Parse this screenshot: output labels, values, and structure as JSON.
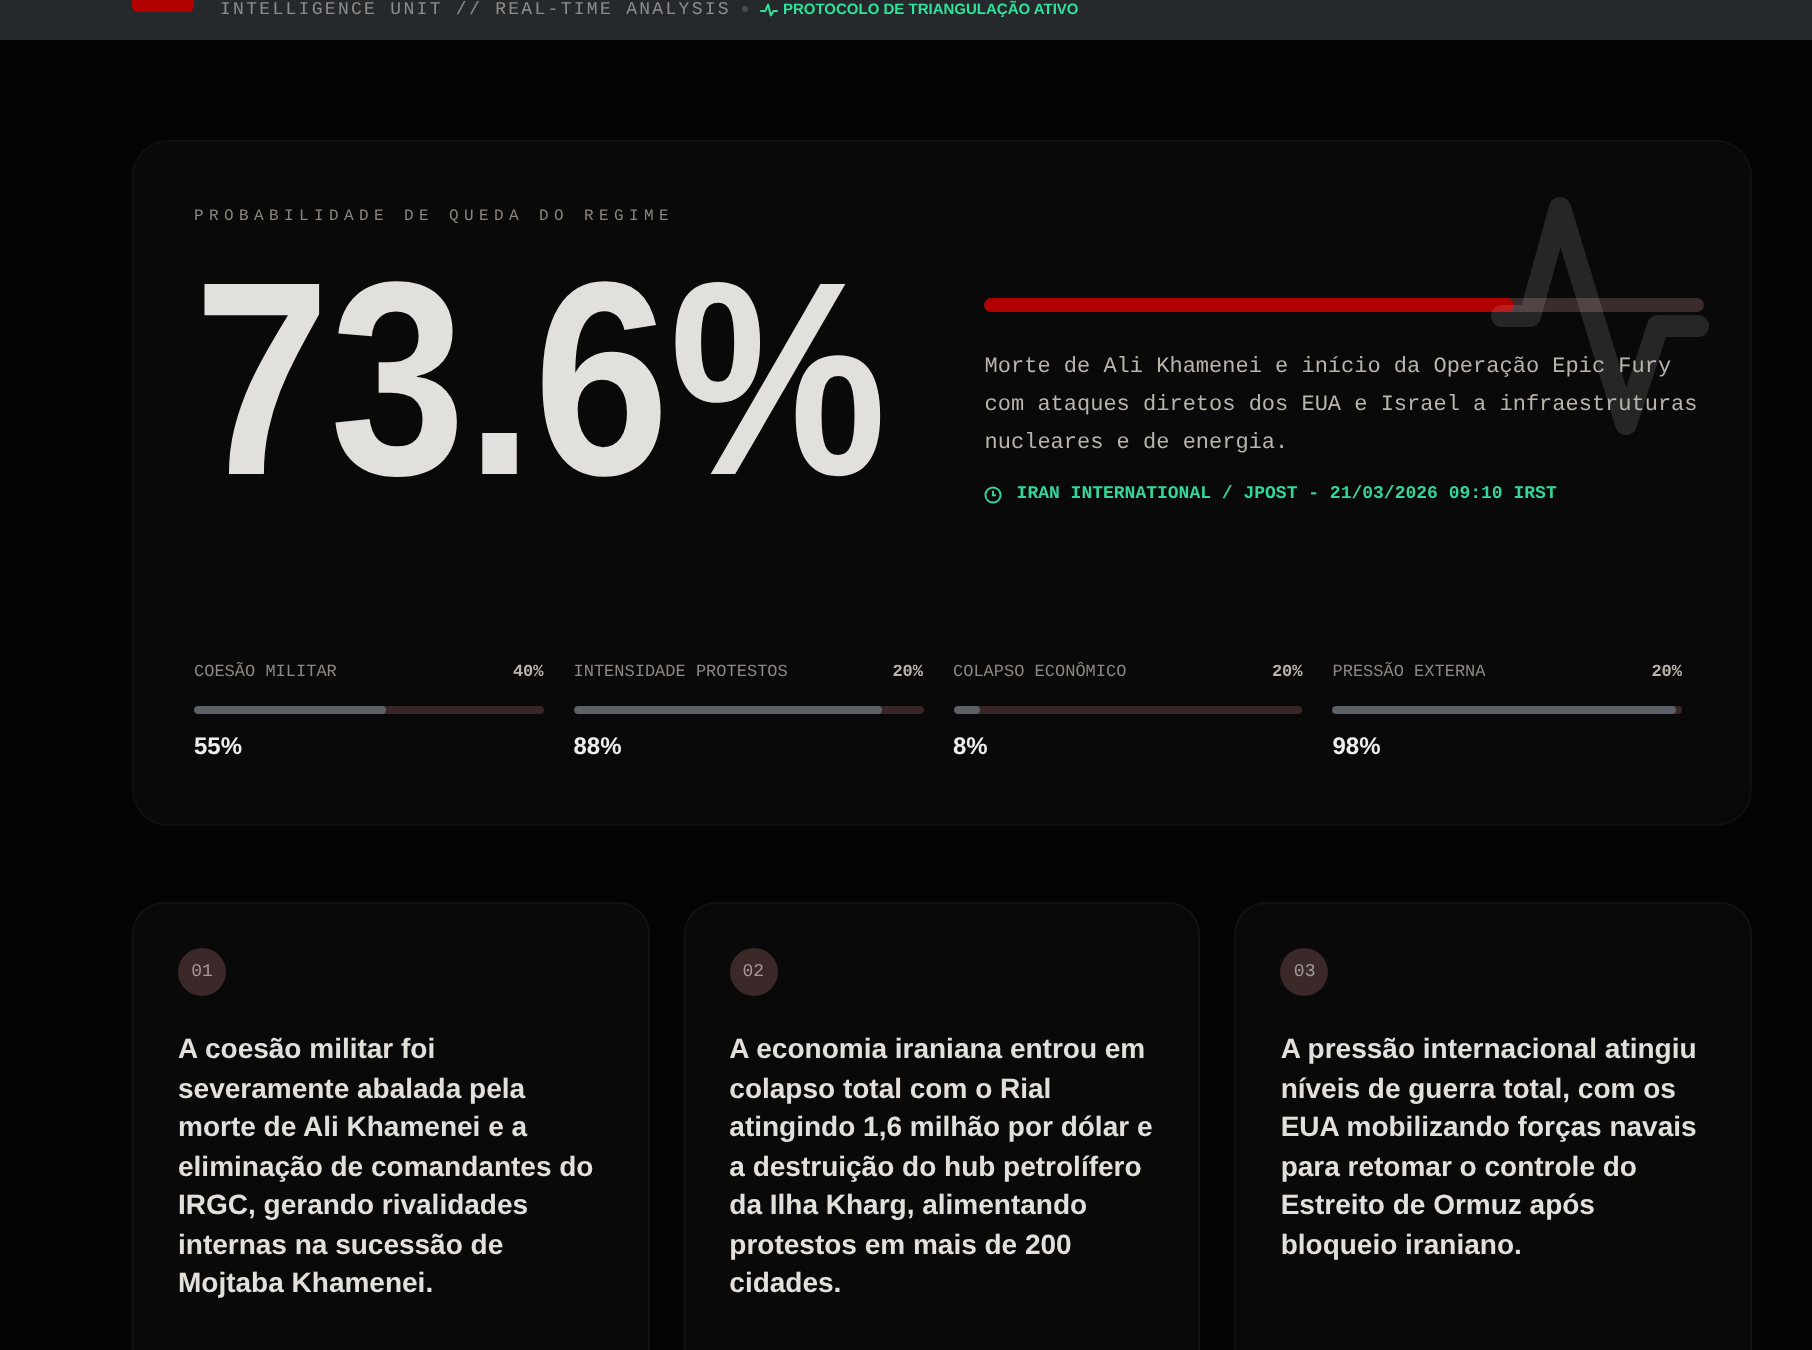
{
  "header": {
    "subtitle": "INTELLIGENCE UNIT // REAL-TIME ANALYSIS",
    "status": "PROTOCOLO DE TRIANGULAÇÃO ATIVO"
  },
  "probability": {
    "label": "PROBABILIDADE DE QUEDA DO REGIME",
    "value": "73.6%",
    "level": 0.736,
    "description": "Morte de Ali Khamenei e início da Operação Epic Fury com ataques diretos dos EUA e Israel a infraestruturas nucleares e de energia.",
    "source": "IRAN INTERNATIONAL / JPOST - 21/03/2026 09:10 IRST"
  },
  "factors": [
    {
      "label": "COESÃO MILITAR",
      "weight": "40%",
      "level": 0.55,
      "value": "55%"
    },
    {
      "label": "INTENSIDADE PROTESTOS",
      "weight": "20%",
      "level": 0.88,
      "value": "88%"
    },
    {
      "label": "COLAPSO ECONÔMICO",
      "weight": "20%",
      "level": 0.08,
      "value": "8%"
    },
    {
      "label": "PRESSÃO EXTERNA",
      "weight": "20%",
      "level": 0.98,
      "value": "98%"
    }
  ],
  "analysis_cards": [
    {
      "number": "01",
      "text": "A coesão militar foi severamente abalada pela morte de Ali Khamenei e a eliminação de comandantes do IRGC, gerando rivalidades internas na sucessão de Mojtaba Khamenei."
    },
    {
      "number": "02",
      "text": "A economia iraniana entrou em colapso total com o Rial atingindo 1,6 milhão por dólar e a destruição do hub petrolífero da Ilha Kharg, alimentando protestos em mais de 200 cidades."
    },
    {
      "number": "03",
      "text": "A pressão internacional atingiu níveis de guerra total, com os EUA mobilizando forças navais para retomar o controle do Estreito de Ormuz após bloqueio iraniano."
    }
  ]
}
